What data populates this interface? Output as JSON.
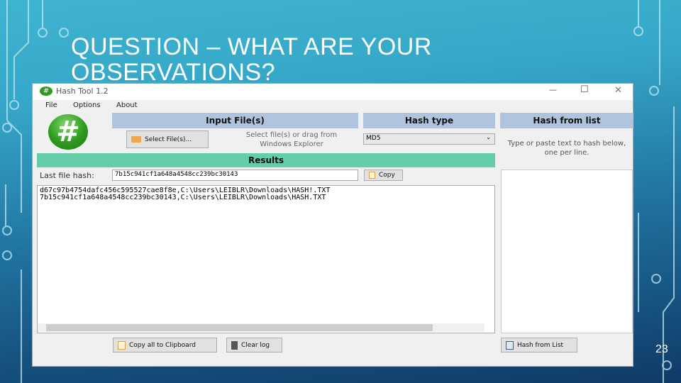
{
  "slide": {
    "title": "QUESTION – WHAT ARE YOUR OBSERVATIONS?",
    "page_number": "23"
  },
  "window": {
    "title": "Hash Tool 1.2",
    "controls": {
      "minimize": "—",
      "maximize": "☐",
      "close": "✕"
    }
  },
  "menu": [
    "File",
    "Options",
    "About"
  ],
  "input": {
    "header": "Input File(s)",
    "select_button": "Select File(s)...",
    "hint": "Select file(s) or drag from Windows Explorer"
  },
  "hash_type": {
    "header": "Hash type",
    "selected": "MD5"
  },
  "hash_from_list": {
    "header": "Hash from list",
    "hint": "Type or paste text to hash below, one per line.",
    "button": "Hash from List"
  },
  "results": {
    "header": "Results",
    "last_hash_label": "Last file hash:",
    "last_hash_value": "7b15c941cf1a648a4548cc239bc30143",
    "copy_button": "Copy",
    "log": [
      "d67c97b4754dafc456c595527cae8f8e,C:\\Users\\LEIBLR\\Downloads\\HASH!.TXT",
      "7b15c941cf1a648a4548cc239bc30143,C:\\Users\\LEIBLR\\Downloads\\HASH.TXT"
    ],
    "copy_all_button": "Copy all to Clipboard",
    "clear_log_button": "Clear log"
  },
  "colors": {
    "input_header": "#b0c4de",
    "results_header": "#66cdaa",
    "logo": "#2e9a1e"
  }
}
